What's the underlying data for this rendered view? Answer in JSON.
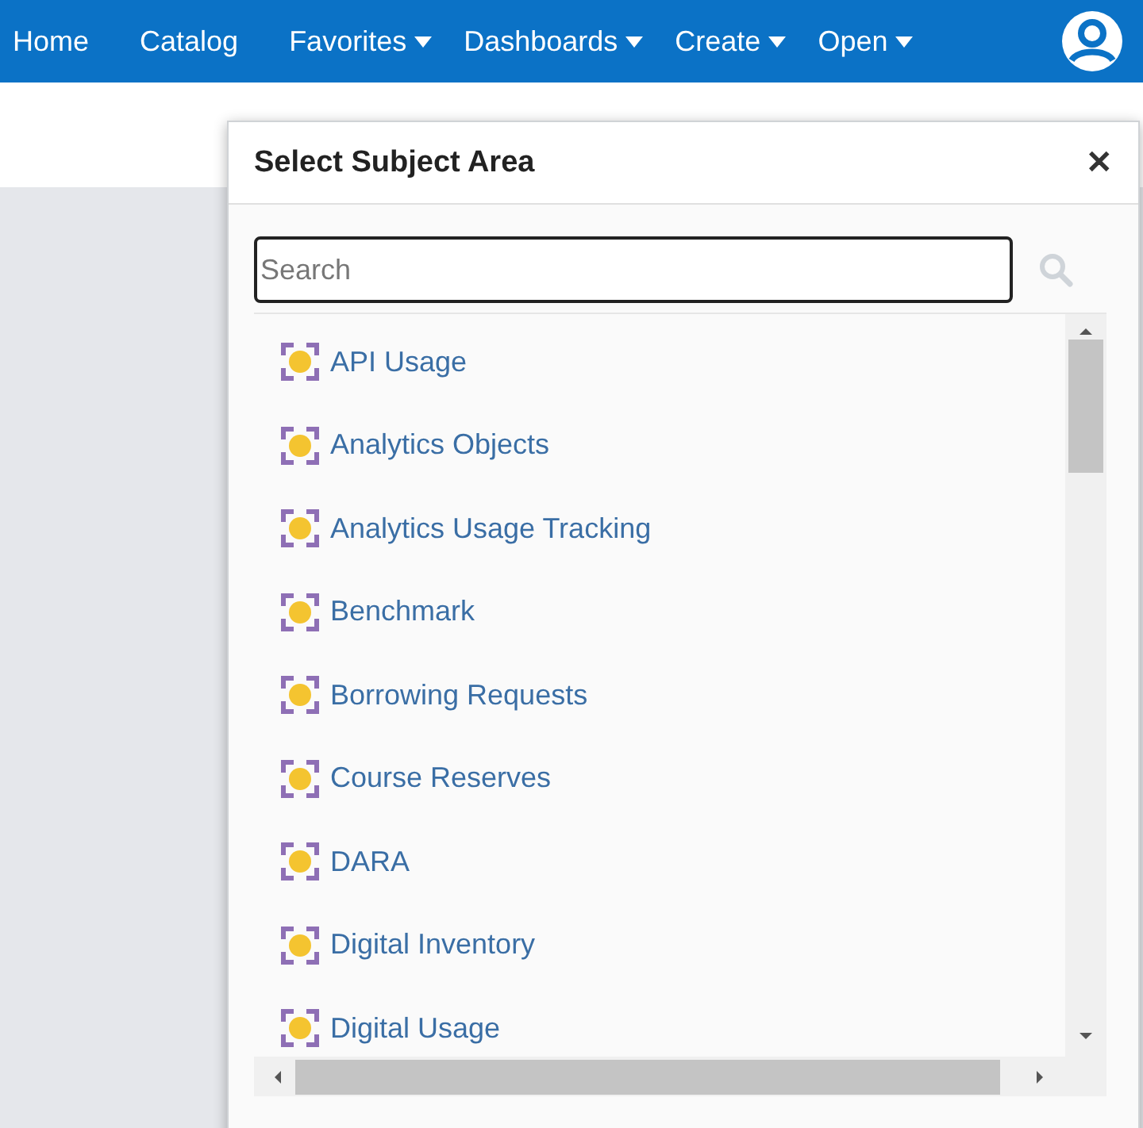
{
  "nav": {
    "items": [
      {
        "label": "Home",
        "menu": false
      },
      {
        "label": "Catalog",
        "menu": false
      },
      {
        "label": "Favorites",
        "menu": true
      },
      {
        "label": "Dashboards",
        "menu": true
      },
      {
        "label": "Create",
        "menu": true
      },
      {
        "label": "Open",
        "menu": true
      }
    ]
  },
  "dialog": {
    "title": "Select Subject Area",
    "close": "✕",
    "search": {
      "placeholder": "Search"
    },
    "items": [
      "API Usage",
      "Analytics Objects",
      "Analytics Usage Tracking",
      "Benchmark",
      "Borrowing Requests",
      "Course Reserves",
      "DARA",
      "Digital Inventory",
      "Digital Usage"
    ]
  }
}
